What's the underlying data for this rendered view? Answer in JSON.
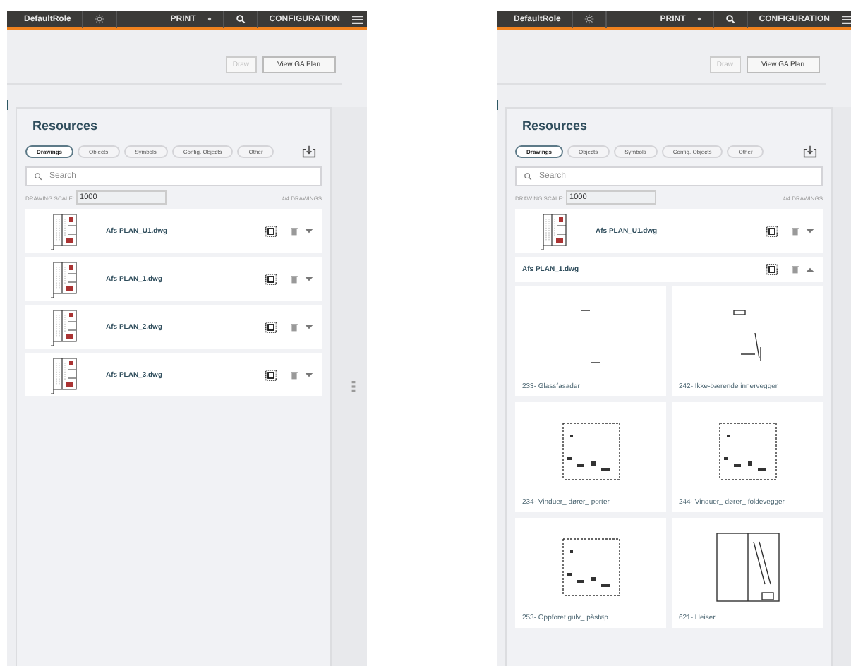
{
  "screens": [
    {
      "topbar": {
        "role": "DefaultRole",
        "print": "PRINT",
        "configuration": "CONFIGURATION"
      },
      "buttons": [
        {
          "label": "Draw",
          "disabled": true
        },
        {
          "label": "View GA Plan",
          "disabled": false
        }
      ],
      "resources": {
        "title": "Resources",
        "tabs": [
          {
            "label": "Drawings",
            "selected": true
          },
          {
            "label": "Objects",
            "selected": false
          },
          {
            "label": "Symbols",
            "selected": false
          },
          {
            "label": "Config. Objects",
            "selected": false
          },
          {
            "label": "Other",
            "selected": false
          }
        ],
        "search": {
          "placeholder": "Search"
        },
        "scale_label": "DRAWING SCALE:",
        "scale_value": "1000",
        "count": "4/4 DRAWINGS",
        "drawings": [
          {
            "name": "Afs PLAN_U1.dwg",
            "expanded": false
          },
          {
            "name": "Afs PLAN_1.dwg",
            "expanded": false
          },
          {
            "name": "Afs PLAN_2.dwg",
            "expanded": false
          },
          {
            "name": "Afs PLAN_3.dwg",
            "expanded": false
          }
        ]
      },
      "splitter_handle": true
    },
    {
      "topbar": {
        "role": "DefaultRole",
        "print": "PRINT",
        "configuration": "CONFIGURATION"
      },
      "buttons": [
        {
          "label": "Draw",
          "disabled": true
        },
        {
          "label": "View GA Plan",
          "disabled": false
        }
      ],
      "resources": {
        "title": "Resources",
        "tabs": [
          {
            "label": "Drawings",
            "selected": true
          },
          {
            "label": "Objects",
            "selected": false
          },
          {
            "label": "Symbols",
            "selected": false
          },
          {
            "label": "Config. Objects",
            "selected": false
          },
          {
            "label": "Other",
            "selected": false
          }
        ],
        "search": {
          "placeholder": "Search"
        },
        "scale_label": "DRAWING SCALE:",
        "scale_value": "1000",
        "count": "4/4 DRAWINGS",
        "drawings": [
          {
            "name": "Afs PLAN_U1.dwg",
            "expanded": false
          },
          {
            "name": "Afs PLAN_1.dwg",
            "expanded": true,
            "layers": [
              {
                "name": "233- Glassfasader"
              },
              {
                "name": "242- Ikke-bærende innervegger"
              },
              {
                "name": "234- Vinduer_ dører_ porter"
              },
              {
                "name": "244- Vinduer_ dører_ foldevegger"
              },
              {
                "name": "253- Oppforet gulv_ påstøp"
              },
              {
                "name": "621- Heiser"
              }
            ]
          }
        ]
      },
      "splitter_handle": false
    }
  ]
}
